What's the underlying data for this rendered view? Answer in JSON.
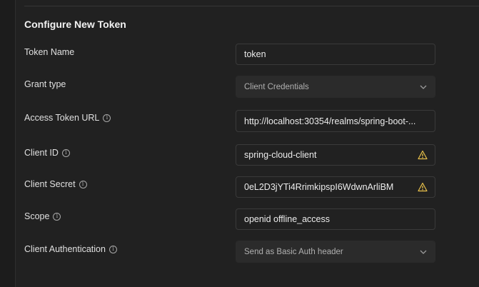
{
  "section": {
    "title": "Configure New Token"
  },
  "fields": {
    "token_name": {
      "label": "Token Name",
      "value": "token"
    },
    "grant_type": {
      "label": "Grant type",
      "value": "Client Credentials"
    },
    "access_token_url": {
      "label": "Access Token URL",
      "value": "http://localhost:30354/realms/spring-boot-..."
    },
    "client_id": {
      "label": "Client ID",
      "value": "spring-cloud-client"
    },
    "client_secret": {
      "label": "Client Secret",
      "value": "0eL2D3jYTi4RrimkipspI6WdwnArliBM"
    },
    "scope": {
      "label": "Scope",
      "value": "openid offline_access"
    },
    "client_authentication": {
      "label": "Client Authentication",
      "value": "Send as Basic Auth header"
    }
  },
  "icons": {
    "info": "info-icon",
    "warning": "warning-icon",
    "dropdown": "chevron-down-icon"
  },
  "colors": {
    "background": "#212121",
    "field_border": "#3a3a3a",
    "select_background": "#2b2b2b",
    "warning": "#e8c04a"
  }
}
